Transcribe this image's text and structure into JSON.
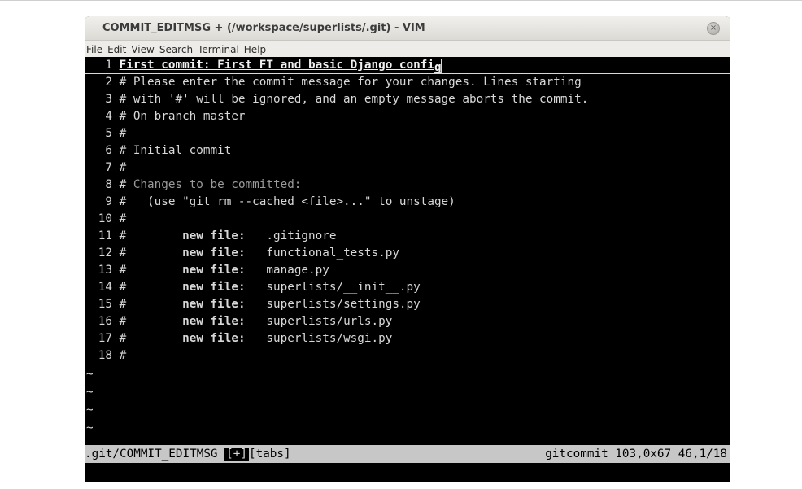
{
  "window": {
    "title": "COMMIT_EDITMSG + (/workspace/superlists/.git) - VIM",
    "close_glyph": "×"
  },
  "menu": [
    "File",
    "Edit",
    "View",
    "Search",
    "Terminal",
    "Help"
  ],
  "lines": [
    {
      "num": "1",
      "text": "First commit: First FT and basic Django confi",
      "cursor_char": "g"
    },
    {
      "num": "2",
      "text": "# Please enter the commit message for your changes. Lines starting"
    },
    {
      "num": "3",
      "text": "# with '#' will be ignored, and an empty message aborts the commit."
    },
    {
      "num": "4",
      "text": "# On branch master"
    },
    {
      "num": "5",
      "text": "#"
    },
    {
      "num": "6",
      "text": "# Initial commit"
    },
    {
      "num": "7",
      "text": "#"
    },
    {
      "num": "8",
      "text_hash": "# ",
      "text": "Changes to be committed:"
    },
    {
      "num": "9",
      "text": "#   (use \"git rm --cached <file>...\" to unstage)"
    },
    {
      "num": "10",
      "text": "#"
    },
    {
      "num": "11",
      "hash": "#",
      "label": "new file:",
      "file": ".gitignore"
    },
    {
      "num": "12",
      "hash": "#",
      "label": "new file:",
      "file": "functional_tests.py"
    },
    {
      "num": "13",
      "hash": "#",
      "label": "new file:",
      "file": "manage.py"
    },
    {
      "num": "14",
      "hash": "#",
      "label": "new file:",
      "file": "superlists/__init__.py"
    },
    {
      "num": "15",
      "hash": "#",
      "label": "new file:",
      "file": "superlists/settings.py"
    },
    {
      "num": "16",
      "hash": "#",
      "label": "new file:",
      "file": "superlists/urls.py"
    },
    {
      "num": "17",
      "hash": "#",
      "label": "new file:",
      "file": "superlists/wsgi.py"
    },
    {
      "num": "18",
      "text": "#"
    }
  ],
  "tilde": "~",
  "status": {
    "filename": ".git/COMMIT_EDITMSG",
    "modified": "[+]",
    "tabs": "[tabs]",
    "right": "gitcommit 103,0x67 46,1/18"
  },
  "colors": {
    "background": "#000000",
    "text": "#d8d8d8",
    "statusline_bg": "#c7c7c7"
  }
}
